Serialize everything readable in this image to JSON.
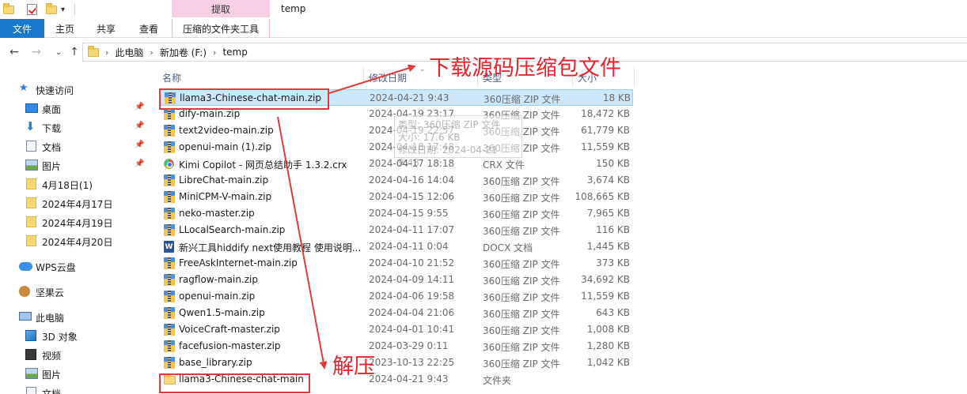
{
  "window": {
    "title": "temp",
    "context_header": "提取"
  },
  "ribbon": {
    "tabs": [
      {
        "label": "文件"
      },
      {
        "label": "主页"
      },
      {
        "label": "共享"
      },
      {
        "label": "查看"
      },
      {
        "label": "压缩的文件夹工具"
      }
    ]
  },
  "address": {
    "crumbs": [
      "此电脑",
      "新加卷 (F:)",
      "temp"
    ]
  },
  "nav": {
    "quick_access": "快速访问",
    "items": [
      {
        "label": "桌面",
        "icon": "desktop-icon",
        "pinned": true
      },
      {
        "label": "下载",
        "icon": "download-icon",
        "pinned": true
      },
      {
        "label": "文档",
        "icon": "document-icon",
        "pinned": true
      },
      {
        "label": "图片",
        "icon": "picture-icon",
        "pinned": true
      },
      {
        "label": "4月18日(1)",
        "icon": "folder-icon",
        "pinned": false
      },
      {
        "label": "2024年4月17日",
        "icon": "folder-icon",
        "pinned": false
      },
      {
        "label": "2024年4月19日",
        "icon": "folder-icon",
        "pinned": false
      },
      {
        "label": "2024年4月20日",
        "icon": "folder-icon",
        "pinned": false
      }
    ],
    "wps": "WPS云盘",
    "jianguoyun": "坚果云",
    "this_pc": "此电脑",
    "pc_items": [
      {
        "label": "3D 对象",
        "icon": "3d-objects-icon"
      },
      {
        "label": "视频",
        "icon": "video-icon"
      },
      {
        "label": "图片",
        "icon": "picture-icon"
      },
      {
        "label": "文档",
        "icon": "document-icon"
      }
    ]
  },
  "columns": {
    "name": "名称",
    "date": "修改日期",
    "type": "类型",
    "size": "大小"
  },
  "files": [
    {
      "name": "llama3-Chinese-chat-main.zip",
      "date": "2024-04-21 9:43",
      "type": "360压缩 ZIP 文件",
      "size": "18 KB",
      "icon": "zip",
      "selected": true
    },
    {
      "name": "dify-main.zip",
      "date": "2024-04-19 23:17",
      "type": "360压缩 ZIP 文件",
      "size": "18,472 KB",
      "icon": "zip"
    },
    {
      "name": "text2video-main.zip",
      "date": "2024-04-19 22:57",
      "type": "360压缩 ZIP 文件",
      "size": "61,779 KB",
      "icon": "zip"
    },
    {
      "name": "openui-main (1).zip",
      "date": "2024-04-18 17:48",
      "type": "360压缩 ZIP 文件",
      "size": "11,559 KB",
      "icon": "zip"
    },
    {
      "name": "Kimi Copilot - 网页总结助手 1.3.2.crx",
      "date": "2024-04-17 18:18",
      "type": "CRX 文件",
      "size": "150 KB",
      "icon": "crx"
    },
    {
      "name": "LibreChat-main.zip",
      "date": "2024-04-16 14:04",
      "type": "360压缩 ZIP 文件",
      "size": "3,674 KB",
      "icon": "zip"
    },
    {
      "name": "MiniCPM-V-main.zip",
      "date": "2024-04-15 12:06",
      "type": "360压缩 ZIP 文件",
      "size": "108,665 KB",
      "icon": "zip"
    },
    {
      "name": "neko-master.zip",
      "date": "2024-04-15 9:55",
      "type": "360压缩 ZIP 文件",
      "size": "7,965 KB",
      "icon": "zip"
    },
    {
      "name": "LLocalSearch-main.zip",
      "date": "2024-04-11 17:07",
      "type": "360压缩 ZIP 文件",
      "size": "116 KB",
      "icon": "zip"
    },
    {
      "name": "新兴工具hiddify next使用教程 使用说明...",
      "date": "2024-04-11 0:04",
      "type": "DOCX 文档",
      "size": "1,445 KB",
      "icon": "docx"
    },
    {
      "name": "FreeAskInternet-main.zip",
      "date": "2024-04-10 21:52",
      "type": "360压缩 ZIP 文件",
      "size": "373 KB",
      "icon": "zip"
    },
    {
      "name": "ragflow-main.zip",
      "date": "2024-04-09 14:11",
      "type": "360压缩 ZIP 文件",
      "size": "34,692 KB",
      "icon": "zip"
    },
    {
      "name": "openui-main.zip",
      "date": "2024-04-06 19:58",
      "type": "360压缩 ZIP 文件",
      "size": "11,559 KB",
      "icon": "zip"
    },
    {
      "name": "Qwen1.5-main.zip",
      "date": "2024-04-04 21:06",
      "type": "360压缩 ZIP 文件",
      "size": "643 KB",
      "icon": "zip"
    },
    {
      "name": "VoiceCraft-master.zip",
      "date": "2024-04-01 10:41",
      "type": "360压缩 ZIP 文件",
      "size": "1,008 KB",
      "icon": "zip"
    },
    {
      "name": "facefusion-master.zip",
      "date": "2024-03-29 0:11",
      "type": "360压缩 ZIP 文件",
      "size": "1,280 KB",
      "icon": "zip"
    },
    {
      "name": "base_library.zip",
      "date": "2023-10-13 22:25",
      "type": "360压缩 ZIP 文件",
      "size": "1,042 KB",
      "icon": "zip"
    },
    {
      "name": "llama3-Chinese-chat-main",
      "date": "2024-04-21 9:43",
      "type": "文件夹",
      "size": "",
      "icon": "folder"
    }
  ],
  "tooltip": {
    "line1": "类型: 360压缩 ZIP 文件",
    "line2": "大小: 17.6 KB",
    "line3": "修改日期: 2024-04-21 9:43"
  },
  "annotations": {
    "download_label": "下载源码压缩包文件",
    "extract_label": "解压",
    "color": "#e8232b"
  }
}
